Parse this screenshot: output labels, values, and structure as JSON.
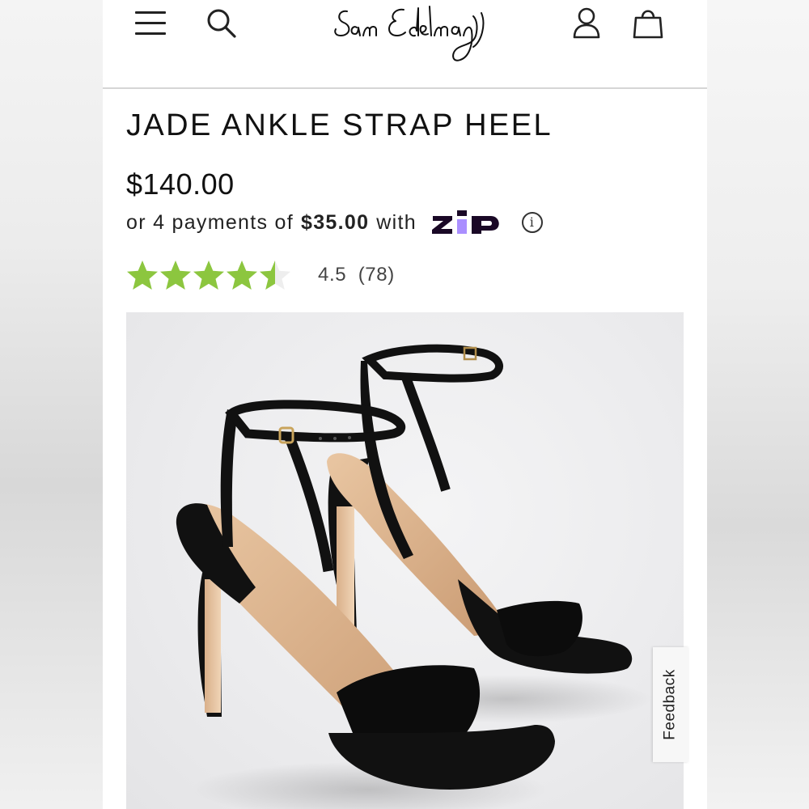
{
  "brand": {
    "logo_text": "Sam Edelman"
  },
  "header": {
    "menu_icon": "hamburger-menu-icon",
    "search_icon": "search-icon",
    "account_icon": "user-account-icon",
    "bag_icon": "shopping-bag-icon"
  },
  "product": {
    "title": "JADE ANKLE STRAP HEEL",
    "price": "$140.00",
    "installments": {
      "prefix": "or 4 payments of",
      "amount": "$35.00",
      "suffix": "with",
      "provider": "ZIP",
      "info_icon": "info-icon"
    },
    "rating": {
      "value": 4.5,
      "count": "(78)",
      "text": "4.5",
      "star_color": "#8cc63f"
    }
  },
  "feedback": {
    "label": "Feedback"
  },
  "colors": {
    "zip_purple": "#1a0826",
    "zip_lilac": "#aa8fff",
    "text": "#111111"
  }
}
